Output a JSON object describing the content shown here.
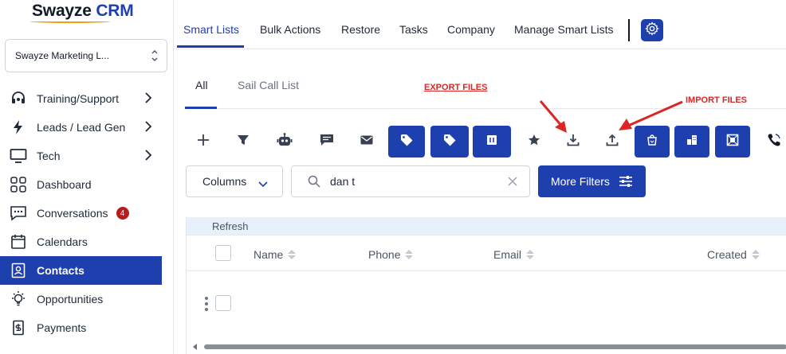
{
  "logo": {
    "name": "Swayze",
    "accent": "CRM"
  },
  "account": {
    "name": "Swayze Marketing L..."
  },
  "sidebar": {
    "items": [
      {
        "label": "Training/Support",
        "icon": "headset-icon"
      },
      {
        "label": "Leads / Lead Gen",
        "icon": "bolt-icon"
      },
      {
        "label": "Tech",
        "icon": "monitor-icon"
      },
      {
        "label": "Dashboard",
        "icon": "grid-icon"
      },
      {
        "label": "Conversations",
        "icon": "chat-icon",
        "badge": "4"
      },
      {
        "label": "Calendars",
        "icon": "calendar-icon"
      },
      {
        "label": "Contacts",
        "icon": "contact-card-icon",
        "active": true
      },
      {
        "label": "Opportunities",
        "icon": "lightbulb-icon"
      },
      {
        "label": "Payments",
        "icon": "receipt-icon"
      }
    ]
  },
  "topnav": {
    "tabs": [
      {
        "label": "Smart Lists",
        "active": true
      },
      {
        "label": "Bulk Actions"
      },
      {
        "label": "Restore"
      },
      {
        "label": "Tasks"
      },
      {
        "label": "Company"
      },
      {
        "label": "Manage Smart Lists"
      }
    ]
  },
  "subnav": {
    "tabs": [
      {
        "label": "All",
        "active": true
      },
      {
        "label": "Sail Call List"
      }
    ]
  },
  "annotations": {
    "export": "EXPORT FILES",
    "import": "IMPORT FILES"
  },
  "toolbar": {
    "icons": [
      "plus-icon",
      "filter-icon",
      "robot-icon",
      "message-icon",
      "mail-icon",
      "tag-add-icon",
      "tag-remove-icon",
      "delete-icon",
      "star-icon",
      "download-icon",
      "upload-icon",
      "bag-icon",
      "building-icon",
      "merge-icon",
      "phone-icon"
    ]
  },
  "filters": {
    "columns_label": "Columns",
    "search_value": "dan t",
    "more_filters_label": "More Filters"
  },
  "table": {
    "refresh_label": "Refresh",
    "columns": [
      "Name",
      "Phone",
      "Email",
      "Created"
    ]
  },
  "colors": {
    "primary": "#1e40af",
    "badge": "#b91c1c",
    "annotation": "#dc2626"
  }
}
